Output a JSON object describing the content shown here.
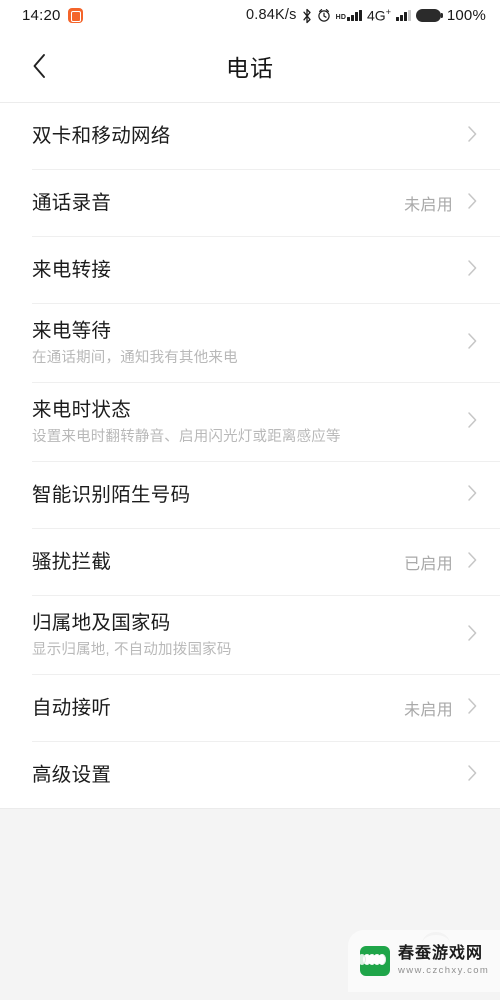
{
  "status_bar": {
    "time": "14:20",
    "app_icon": "alarm-app-icon",
    "net_speed": "0.84K/s",
    "bluetooth_icon": "bluetooth-icon",
    "alarm_icon": "alarm-clock-icon",
    "hd_label": "HD",
    "network_type": "4G",
    "network_superscript": "+",
    "battery_percent": "100%"
  },
  "header": {
    "back_icon": "chevron-left-icon",
    "title": "电话"
  },
  "settings": {
    "items": [
      {
        "title": "双卡和移动网络",
        "subtitle": "",
        "value": ""
      },
      {
        "title": "通话录音",
        "subtitle": "",
        "value": "未启用"
      },
      {
        "title": "来电转接",
        "subtitle": "",
        "value": ""
      },
      {
        "title": "来电等待",
        "subtitle": "在通话期间，通知我有其他来电",
        "value": ""
      },
      {
        "title": "来电时状态",
        "subtitle": "设置来电时翻转静音、启用闪光灯或距离感应等",
        "value": ""
      },
      {
        "title": "智能识别陌生号码",
        "subtitle": "",
        "value": ""
      },
      {
        "title": "骚扰拦截",
        "subtitle": "",
        "value": "已启用"
      },
      {
        "title": "归属地及国家码",
        "subtitle": "显示归属地, 不自动加拨国家码",
        "value": ""
      },
      {
        "title": "自动接听",
        "subtitle": "",
        "value": "未启用"
      },
      {
        "title": "高级设置",
        "subtitle": "",
        "value": ""
      }
    ]
  },
  "watermark": {
    "name": "春蚕游戏网",
    "url": "www.czchxy.com",
    "logo_icon": "silkworm-logo-icon",
    "brand_color": "#19a344"
  },
  "colors": {
    "background": "#f4f4f4",
    "surface": "#ffffff",
    "title_text": "#171717",
    "body_text": "#1c1c1c",
    "muted_text": "#b9b9b9",
    "value_text": "#a9a9a9",
    "divider": "#efefef",
    "accent_orange": "#f4642a"
  }
}
